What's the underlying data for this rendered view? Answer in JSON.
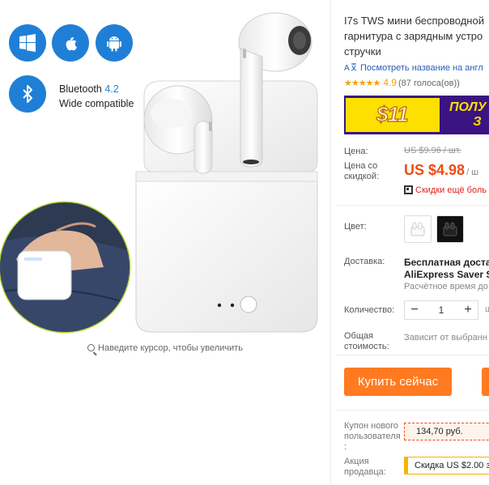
{
  "gallery": {
    "bluetooth_label": "Bluetooth",
    "bluetooth_version": "4.2",
    "bluetooth_sub": "Wide compatible",
    "zoom_hint": "Наведите курсор, чтобы увеличить",
    "os_icons": [
      "windows-icon",
      "apple-icon",
      "android-icon"
    ],
    "accent_color": "#1f7fd6"
  },
  "product": {
    "title_lines": [
      "I7s TWS мини беспроводной",
      "гарнитура с зарядным устро",
      "стручки"
    ],
    "translate_link": "Посмотреть название на англ",
    "rating_value": "4.9",
    "rating_count": "(87 голоса(ов))"
  },
  "promo": {
    "price": "$11",
    "right_text_1": "ПОЛУ",
    "right_text_2": "З"
  },
  "price": {
    "label": "Цена:",
    "old": "US $9.96 / шт.",
    "discount_label_1": "Цена со",
    "discount_label_2": "скидкой:",
    "new": "US $4.98",
    "unit": "/ ш",
    "more_discounts": "Скидки ещё боль",
    "accent_color": "#f24b11"
  },
  "color": {
    "label": "Цвет:",
    "options": [
      "white",
      "black"
    ]
  },
  "shipping": {
    "label": "Доставка:",
    "title_1": "Бесплатная достав",
    "title_2": "AliExpress Saver Shi",
    "sub": "Расчётное время до"
  },
  "quantity": {
    "label": "Количество:",
    "value": "1",
    "minus": "−",
    "plus": "+",
    "note": "ш"
  },
  "total": {
    "label_1": "Общая",
    "label_2": "стоимость:",
    "value": "Зависит от выбранн"
  },
  "actions": {
    "buy_now": "Купить сейчас"
  },
  "coupons": {
    "new_user_label_1": "Купон нового",
    "new_user_label_2": "пользователя",
    "new_user_label_3": ":",
    "new_user_amount": "134,70 руб.",
    "seller_label_1": "Акция",
    "seller_label_2": "продавца:",
    "seller_text": "Скидка US $2.00 за"
  }
}
